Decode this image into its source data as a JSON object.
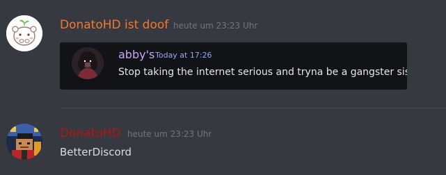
{
  "messages": [
    {
      "author": "DonatoHD ist doof",
      "timestamp": "heute um 23:23 Uhr",
      "author_color": "#f57731",
      "avatar_icon": "bear-mascot-avatar",
      "attachment": {
        "type": "image",
        "quoted_author": "abby's",
        "quoted_timestamp": "Today at 17:26",
        "quoted_text": "Stop taking the internet serious and tryna be a gangster sis",
        "quoted_author_color": "#c8a6f7"
      }
    },
    {
      "author": "DonatoHD",
      "timestamp": "heute um 23:23 Uhr",
      "author_color": "#b41414",
      "avatar_icon": "blocky-character-avatar",
      "content": "BetterDiscord"
    }
  ]
}
